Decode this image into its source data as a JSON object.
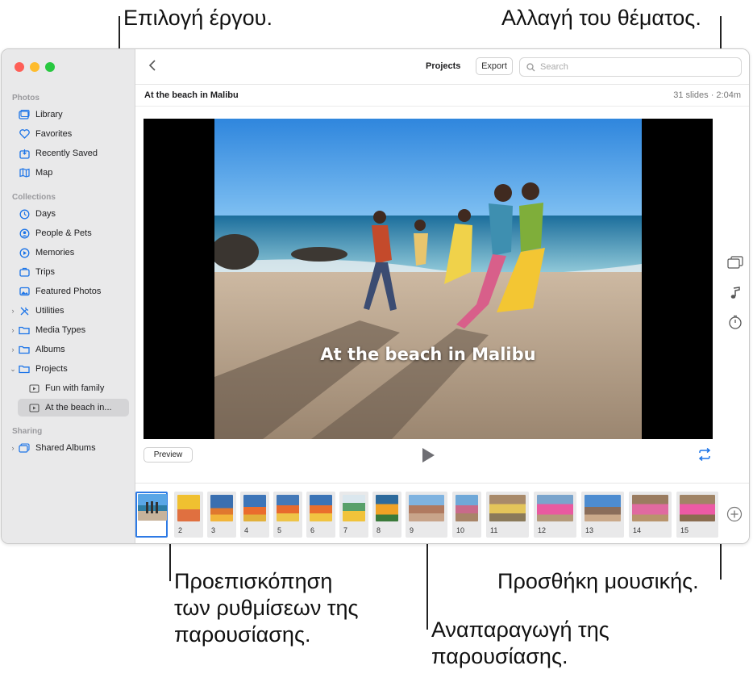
{
  "callouts": {
    "select_project": "Επιλογή έργου.",
    "change_theme": "Αλλαγή του θέματος.",
    "preview_line1": "Προεπισκόπηση",
    "preview_line2": "των ρυθμίσεων της",
    "preview_line3": "παρουσίασης.",
    "add_music": "Προσθήκη μουσικής.",
    "play_line1": "Αναπαραγωγή της",
    "play_line2": "παρουσίασης."
  },
  "sidebar": {
    "photos_header": "Photos",
    "photos_items": [
      {
        "label": "Library",
        "icon": "library-icon"
      },
      {
        "label": "Favorites",
        "icon": "heart-icon"
      },
      {
        "label": "Recently Saved",
        "icon": "recently-saved-icon"
      },
      {
        "label": "Map",
        "icon": "map-icon"
      }
    ],
    "collections_header": "Collections",
    "collections_items": [
      {
        "label": "Days",
        "icon": "clock-icon"
      },
      {
        "label": "People & Pets",
        "icon": "person-icon"
      },
      {
        "label": "Memories",
        "icon": "memories-icon"
      },
      {
        "label": "Trips",
        "icon": "suitcase-icon"
      },
      {
        "label": "Featured Photos",
        "icon": "photo-icon"
      },
      {
        "label": "Utilities",
        "icon": "tools-icon"
      },
      {
        "label": "Media Types",
        "icon": "folder-icon"
      },
      {
        "label": "Albums",
        "icon": "folder-icon"
      },
      {
        "label": "Projects",
        "icon": "folder-icon"
      },
      {
        "label": "Fun with family",
        "icon": "slideshow-icon"
      },
      {
        "label": "At the beach in...",
        "icon": "slideshow-icon"
      }
    ],
    "sharing_header": "Sharing",
    "sharing_items": [
      {
        "label": "Shared Albums",
        "icon": "shared-albums-icon"
      }
    ]
  },
  "toolbar": {
    "title": "Projects",
    "export_label": "Export",
    "search_placeholder": "Search"
  },
  "project": {
    "title": "At the beach in Malibu",
    "meta": "31 slides · 2:04m",
    "slide_caption": "At the beach in Malibu"
  },
  "controls": {
    "preview_label": "Preview"
  },
  "filmstrip": {
    "numbers": [
      "2",
      "3",
      "4",
      "5",
      "6",
      "7",
      "8",
      "9",
      "10",
      "11",
      "12",
      "13",
      "14",
      "15"
    ]
  }
}
